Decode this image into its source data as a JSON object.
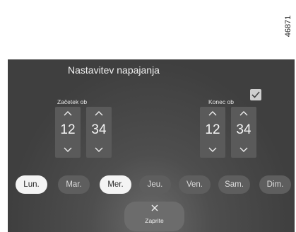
{
  "figure_ref": "46871",
  "title": "Nastavitev napajanja",
  "start": {
    "label": "Začetek ob",
    "hours": "12",
    "minutes": "34"
  },
  "end": {
    "label": "Konec ob",
    "checked": true,
    "hours": "12",
    "minutes": "34"
  },
  "days": [
    {
      "label": "Lun.",
      "selected": true
    },
    {
      "label": "Mar.",
      "selected": false
    },
    {
      "label": "Mer.",
      "selected": true
    },
    {
      "label": "Jeu.",
      "selected": false
    },
    {
      "label": "Ven.",
      "selected": false
    },
    {
      "label": "Sam.",
      "selected": false
    },
    {
      "label": "Dim.",
      "selected": false
    }
  ],
  "close_label": "Zaprite",
  "icons": {
    "up": "chevron-up-icon",
    "down": "chevron-down-icon",
    "check": "check-icon",
    "close": "close-icon"
  }
}
